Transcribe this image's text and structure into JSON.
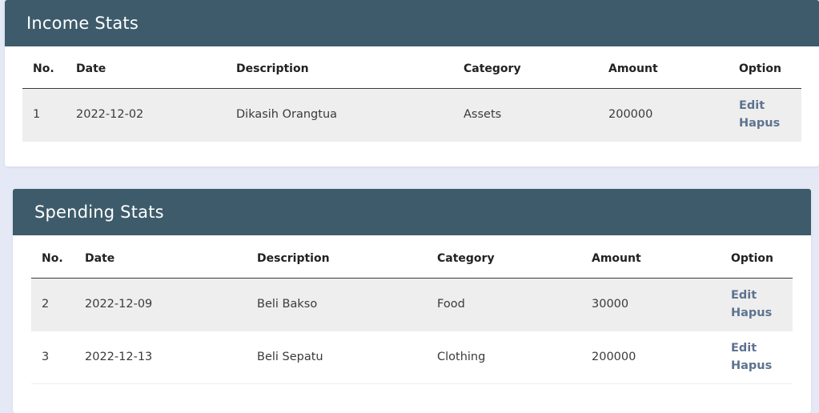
{
  "income": {
    "title": "Income Stats",
    "columns": [
      "No.",
      "Date",
      "Description",
      "Category",
      "Amount",
      "Option"
    ],
    "rows": [
      {
        "no": "1",
        "date": "2022-12-02",
        "description": "Dikasih Orangtua",
        "category": "Assets",
        "amount": "200000",
        "edit": "Edit",
        "delete": "Hapus"
      }
    ]
  },
  "spending": {
    "title": "Spending Stats",
    "columns": [
      "No.",
      "Date",
      "Description",
      "Category",
      "Amount",
      "Option"
    ],
    "rows": [
      {
        "no": "2",
        "date": "2022-12-09",
        "description": "Beli Bakso",
        "category": "Food",
        "amount": "30000",
        "edit": "Edit",
        "delete": "Hapus"
      },
      {
        "no": "3",
        "date": "2022-12-13",
        "description": "Beli Sepatu",
        "category": "Clothing",
        "amount": "200000",
        "edit": "Edit",
        "delete": "Hapus"
      }
    ]
  },
  "colors": {
    "header_bg": "#3d5b6b",
    "page_bg": "#e4e9f5",
    "link": "#5e7390",
    "stripe": "#eeeeee"
  }
}
